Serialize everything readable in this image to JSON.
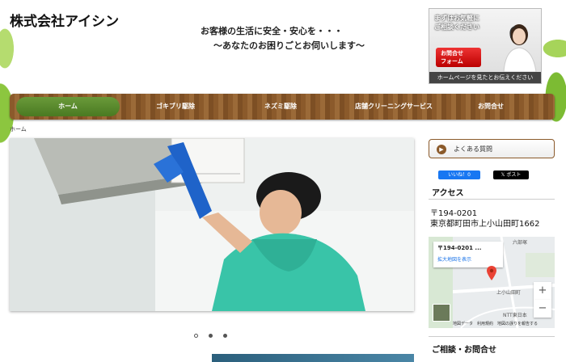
{
  "header": {
    "site_title": "株式会社アイシン",
    "tagline_line1": "お客様の生活に安全・安心を・・・",
    "tagline_line2": "〜あなたのお困りごとお伺いします〜",
    "banner": {
      "line1": "まずはお気軽に",
      "line2": "ご相談ください",
      "button_line1": "お問合せ",
      "button_line2": "フォーム",
      "footer": "ホームページを見たとお伝えください"
    }
  },
  "nav": {
    "items": [
      {
        "label": "ホーム",
        "active": true
      },
      {
        "label": "ゴキブリ駆除",
        "active": false
      },
      {
        "label": "ネズミ駆除",
        "active": false
      },
      {
        "label": "店舗クリーニングサービス",
        "active": false
      },
      {
        "label": "お問合せ",
        "active": false
      }
    ]
  },
  "breadcrumb": {
    "home": "ホーム"
  },
  "slider": {
    "slide_count": 3,
    "active_index": 0
  },
  "sidebar": {
    "faq_label": "よくある質問",
    "facebook_label": "いいね！0",
    "x_label": "ポスト",
    "access_heading": "アクセス",
    "postal": "〒194-0201",
    "address": "東京都町田市上小山田町1662",
    "map": {
      "card_title": "〒194-0201 ...",
      "card_link": "拡大地図を表示",
      "place1": "六部塚",
      "place2": "上小山田町",
      "place3": "NTT東日本",
      "footer_keys": "地図データ　利用規約　地図の誤りを報告する",
      "zoom_in": "+",
      "zoom_out": "−"
    },
    "contact_heading": "ご相談・お問合せ"
  },
  "colors": {
    "nav_brown": "#8b5a2b",
    "nav_active_green": "#5a8a2e",
    "facebook_blue": "#1877f2"
  }
}
